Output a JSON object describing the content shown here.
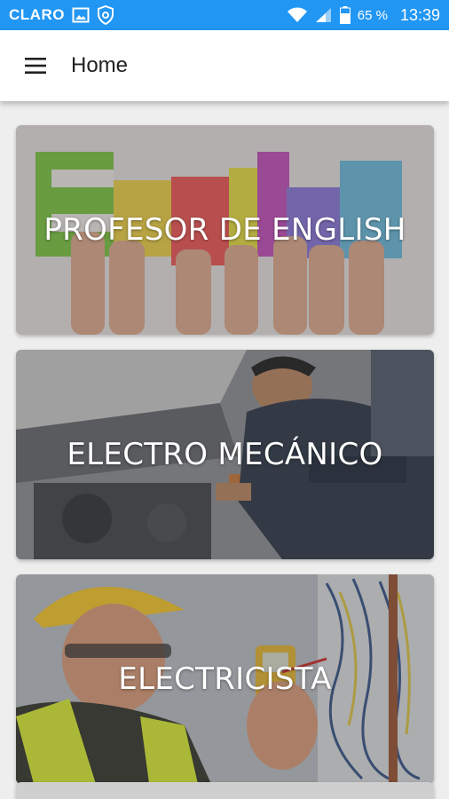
{
  "status_bar": {
    "carrier": "CLARO",
    "battery": "65 %",
    "time": "13:39",
    "icons": [
      "image-icon",
      "shield-icon",
      "wifi-icon",
      "signal-icon",
      "battery-icon"
    ]
  },
  "toolbar": {
    "title": "Home",
    "menu_icon": "hamburger-menu-icon"
  },
  "cards": [
    {
      "title": "PROFESOR DE ENGLISH",
      "image": "english-letters-hands-image"
    },
    {
      "title": "ELECTRO MECÁNICO",
      "image": "mechanic-engine-image"
    },
    {
      "title": "ELECTRICISTA",
      "image": "electrician-multimeter-image"
    }
  ],
  "colors": {
    "status_bar": "#2196f3",
    "toolbar": "#ffffff",
    "background": "#eeeeee"
  }
}
